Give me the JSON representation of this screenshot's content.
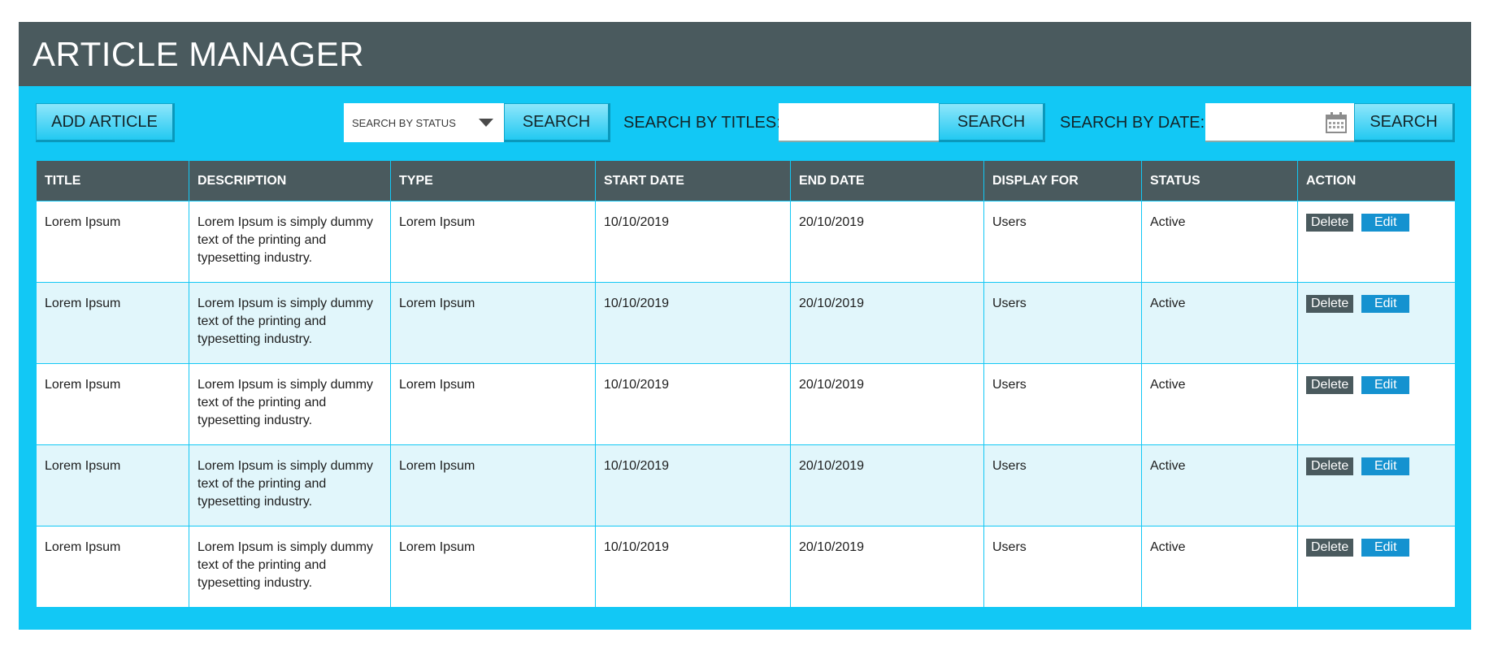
{
  "header": {
    "title": "ARTICLE MANAGER"
  },
  "toolbar": {
    "add_label": "ADD ARTICLE",
    "status_select": "SEARCH BY STATUS",
    "search_label": "SEARCH",
    "titles_label": "SEARCH BY TITLES:",
    "titles_value": "",
    "date_label": "SEARCH BY DATE:",
    "date_value": ""
  },
  "table": {
    "columns": [
      "TITLE",
      "DESCRIPTION",
      "TYPE",
      "START DATE",
      "END DATE",
      "DISPLAY FOR",
      "STATUS",
      "ACTION"
    ],
    "rows": [
      {
        "title": "Lorem Ipsum",
        "description": "Lorem Ipsum is simply dummy text of the printing and typesetting industry.",
        "type": "Lorem Ipsum",
        "start": "10/10/2019",
        "end": "20/10/2019",
        "display": "Users",
        "status": "Active"
      },
      {
        "title": "Lorem Ipsum",
        "description": "Lorem Ipsum is simply dummy text of the printing and typesetting industry.",
        "type": "Lorem Ipsum",
        "start": "10/10/2019",
        "end": "20/10/2019",
        "display": "Users",
        "status": "Active"
      },
      {
        "title": "Lorem Ipsum",
        "description": "Lorem Ipsum is simply dummy text of the printing and typesetting industry.",
        "type": "Lorem Ipsum",
        "start": "10/10/2019",
        "end": "20/10/2019",
        "display": "Users",
        "status": "Active"
      },
      {
        "title": "Lorem Ipsum",
        "description": "Lorem Ipsum is simply dummy text of the printing and typesetting industry.",
        "type": "Lorem Ipsum",
        "start": "10/10/2019",
        "end": "20/10/2019",
        "display": "Users",
        "status": "Active"
      },
      {
        "title": "Lorem Ipsum",
        "description": "Lorem Ipsum is simply dummy text of the printing and typesetting industry.",
        "type": "Lorem Ipsum",
        "start": "10/10/2019",
        "end": "20/10/2019",
        "display": "Users",
        "status": "Active"
      }
    ],
    "delete_label": "Delete",
    "edit_label": "Edit"
  },
  "colors": {
    "accent": "#12c8f5",
    "header": "#4a5a5e",
    "edit": "#1592d0",
    "row_alt": "#e1f6fb"
  },
  "icons": {
    "status_caret": "chevron-down-icon",
    "date_picker": "calendar-icon"
  }
}
